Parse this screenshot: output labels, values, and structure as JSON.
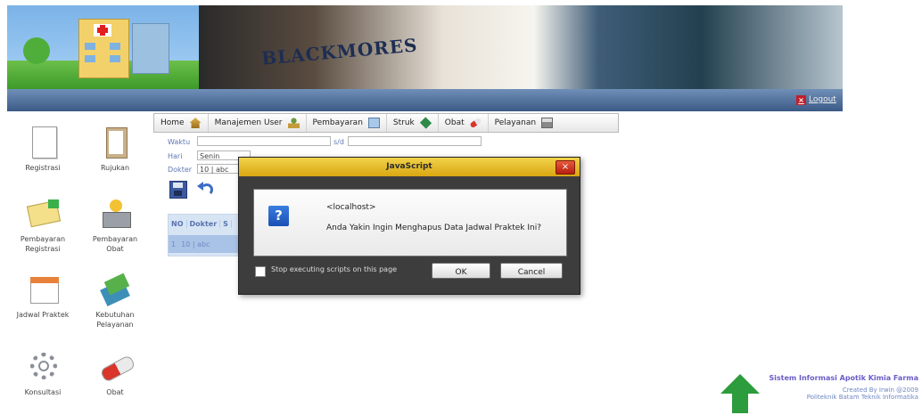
{
  "header": {
    "banner_logo_text": "BLACKMORES",
    "logout_label": "Logout"
  },
  "sidebar": {
    "items": [
      {
        "label": "Registrasi"
      },
      {
        "label": "Rujukan"
      },
      {
        "label": "Pembayaran Registrasi"
      },
      {
        "label": "Pembayaran Obat"
      },
      {
        "label": "Jadwal Praktek"
      },
      {
        "label": "Kebutuhan Pelayanan"
      },
      {
        "label": "Konsultasi"
      },
      {
        "label": "Obat"
      }
    ]
  },
  "menu": {
    "items": [
      {
        "label": "Home"
      },
      {
        "label": "Manajemen User"
      },
      {
        "label": "Pembayaran"
      },
      {
        "label": "Struk"
      },
      {
        "label": "Obat"
      },
      {
        "label": "Pelayanan"
      }
    ]
  },
  "form": {
    "waktu_label": "Waktu",
    "waktu_value": "",
    "sd_label": "s/d",
    "sd_value": "",
    "hari_label": "Hari",
    "hari_value": "Senin",
    "dokter_label": "Dokter",
    "dokter_value": "10 | abc"
  },
  "table": {
    "headers": [
      "NO",
      "Dokter",
      "S"
    ],
    "rows": [
      [
        "1",
        "10 | abc",
        ""
      ]
    ]
  },
  "dialog": {
    "title": "JavaScript",
    "host": "<localhost>",
    "message": "Anda Yakin Ingin Menghapus Data Jadwal Praktek Ini?",
    "checkbox_label": "Stop executing scripts on this page",
    "ok_label": "OK",
    "cancel_label": "Cancel"
  },
  "footer": {
    "title": "Sistem Informasi Apotik Kimia Farma",
    "line1": "Created By Irwin @2009",
    "line2": "Politeknik Batam Teknik Informatika"
  },
  "colors": {
    "navbar": "#4a6a96",
    "dialog_title": "#e8bd2a",
    "footer_title": "#6a5cc8"
  }
}
